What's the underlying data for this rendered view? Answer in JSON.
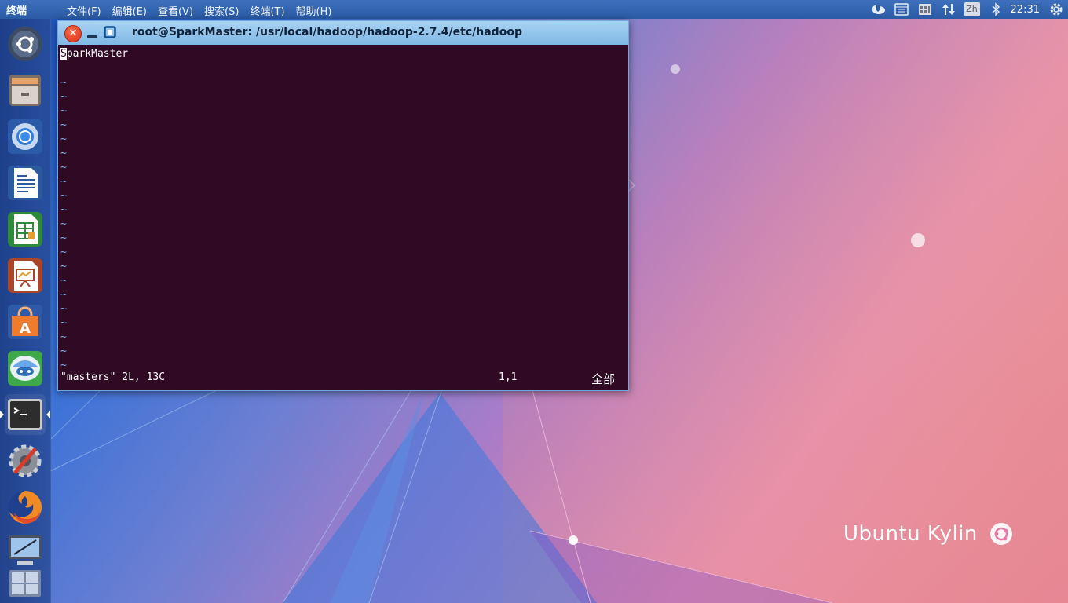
{
  "top_panel": {
    "app_title": "终端",
    "menu": [
      {
        "label": "文件(F)"
      },
      {
        "label": "编辑(E)"
      },
      {
        "label": "查看(V)"
      },
      {
        "label": "搜索(S)"
      },
      {
        "label": "终端(T)"
      },
      {
        "label": "帮助(H)"
      }
    ],
    "tray": {
      "icons": [
        "weather-icon",
        "keyboard-icon",
        "chinese-calendar-icon",
        "network-updown-icon",
        "input-method-icon",
        "bluetooth-icon",
        "settings-gear-icon"
      ],
      "input_method_label": "Zh",
      "clock": "22:31"
    }
  },
  "launcher": {
    "items": [
      {
        "name": "dash-home-icon"
      },
      {
        "name": "files-icon"
      },
      {
        "name": "chromium-icon"
      },
      {
        "name": "libreoffice-writer-icon"
      },
      {
        "name": "libreoffice-calc-icon"
      },
      {
        "name": "libreoffice-impress-icon"
      },
      {
        "name": "software-center-icon"
      },
      {
        "name": "kylin-assistant-icon"
      },
      {
        "name": "terminal-icon",
        "active": true
      },
      {
        "name": "system-tools-icon"
      },
      {
        "name": "firefox-icon"
      },
      {
        "name": "screenshot-tool-icon"
      },
      {
        "name": "workspace-switcher-icon"
      }
    ]
  },
  "terminal": {
    "title": "root@SparkMaster: /usr/local/hadoop/hadoop-2.7.4/etc/hadoop",
    "buffer": {
      "cursor_char": "S",
      "first_line_rest": "parkMaster",
      "tilde": "~"
    },
    "status": {
      "message": "\"masters\" 2L, 13C",
      "position": "1,1",
      "scroll": "全部"
    }
  },
  "desktop": {
    "brand_text": "Ubuntu Kylin"
  },
  "colors": {
    "terminal_bg": "#300a24",
    "titlebar": "#8ec3ec",
    "panel": "#2f5fa8",
    "close_button": "#e0401f"
  }
}
